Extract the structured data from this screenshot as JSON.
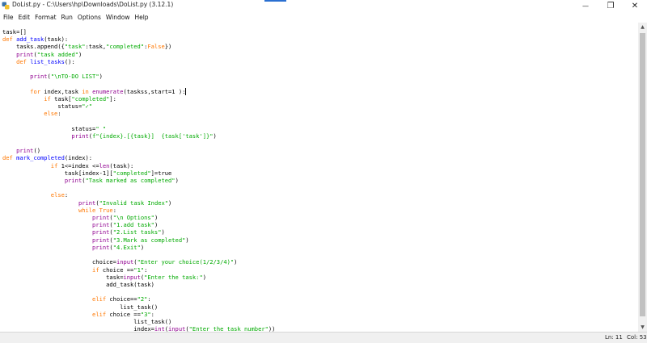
{
  "window": {
    "title": "DoList.py - C:\\Users\\hp\\Downloads\\DoList.py (3.12.1)",
    "minimize_glyph": "—",
    "maximize_glyph": "❐",
    "close_glyph": "✕"
  },
  "menu": [
    "File",
    "Edit",
    "Format",
    "Run",
    "Options",
    "Window",
    "Help"
  ],
  "code_lines": [
    [
      [
        "task=[]",
        ""
      ]
    ],
    [
      [
        "def ",
        "kw"
      ],
      [
        "add_task",
        "fn"
      ],
      [
        "(task):",
        ""
      ]
    ],
    [
      [
        "    tasks.append({",
        ""
      ],
      [
        "\"task\"",
        "st"
      ],
      [
        ":task,",
        ""
      ],
      [
        "\"completed\"",
        "st"
      ],
      [
        ":",
        ""
      ],
      [
        "False",
        "kw"
      ],
      [
        "})",
        ""
      ]
    ],
    [
      [
        "    ",
        ""
      ],
      [
        "print",
        "bi"
      ],
      [
        "(",
        ""
      ],
      [
        "\"task added\"",
        "st"
      ],
      [
        ")",
        ""
      ]
    ],
    [
      [
        "    ",
        ""
      ],
      [
        "def ",
        "kw"
      ],
      [
        "list_tasks",
        "fn"
      ],
      [
        "():",
        ""
      ]
    ],
    [
      [
        "",
        ""
      ]
    ],
    [
      [
        "        ",
        ""
      ],
      [
        "print",
        "bi"
      ],
      [
        "(",
        ""
      ],
      [
        "\"\\nTO-DO LIST\"",
        "st"
      ],
      [
        ")",
        ""
      ]
    ],
    [
      [
        "",
        ""
      ]
    ],
    [
      [
        "        ",
        ""
      ],
      [
        "for ",
        "kw"
      ],
      [
        "index,task ",
        ""
      ],
      [
        "in ",
        "kw"
      ],
      [
        "enumerate",
        "bi"
      ],
      [
        "(taskss,start=1 ):",
        ""
      ],
      [
        "|caret|",
        "caret"
      ]
    ],
    [
      [
        "            ",
        ""
      ],
      [
        "if ",
        "kw"
      ],
      [
        "task[",
        ""
      ],
      [
        "\"completed\"",
        "st"
      ],
      [
        "]:",
        ""
      ]
    ],
    [
      [
        "                status=",
        ""
      ],
      [
        "\"✓\"",
        "st"
      ]
    ],
    [
      [
        "            ",
        ""
      ],
      [
        "else",
        "kw"
      ],
      [
        ":",
        ""
      ]
    ],
    [
      [
        "",
        ""
      ]
    ],
    [
      [
        "                    status=",
        ""
      ],
      [
        "\" \"",
        "st"
      ]
    ],
    [
      [
        "                    ",
        ""
      ],
      [
        "print",
        "bi"
      ],
      [
        "(",
        ""
      ],
      [
        "f\"{index}.[{task}]  {task['task']}\"",
        "st"
      ],
      [
        ")",
        ""
      ]
    ],
    [
      [
        "",
        ""
      ]
    ],
    [
      [
        "    ",
        ""
      ],
      [
        "print",
        "bi"
      ],
      [
        "()",
        ""
      ]
    ],
    [
      [
        "def ",
        "kw"
      ],
      [
        "mark_completed",
        "fn"
      ],
      [
        "(index):",
        ""
      ]
    ],
    [
      [
        "              ",
        ""
      ],
      [
        "if ",
        "kw"
      ],
      [
        "1<=index <=",
        ""
      ],
      [
        "len",
        "bi"
      ],
      [
        "(task):",
        ""
      ]
    ],
    [
      [
        "                  task[index-1][",
        ""
      ],
      [
        "\"completed\"",
        "st"
      ],
      [
        "]=true",
        ""
      ]
    ],
    [
      [
        "                  ",
        ""
      ],
      [
        "print",
        "bi"
      ],
      [
        "(",
        ""
      ],
      [
        "\"Task marked as completed\"",
        "st"
      ],
      [
        ")",
        ""
      ]
    ],
    [
      [
        "",
        ""
      ]
    ],
    [
      [
        "              ",
        ""
      ],
      [
        "else",
        "kw"
      ],
      [
        ":",
        ""
      ]
    ],
    [
      [
        "                      ",
        ""
      ],
      [
        "print",
        "bi"
      ],
      [
        "(",
        ""
      ],
      [
        "\"Invalid task Index\"",
        "st"
      ],
      [
        ")",
        ""
      ]
    ],
    [
      [
        "                      ",
        ""
      ],
      [
        "while ",
        "kw"
      ],
      [
        "True",
        "kw"
      ],
      [
        ":",
        ""
      ]
    ],
    [
      [
        "                          ",
        ""
      ],
      [
        "print",
        "bi"
      ],
      [
        "(",
        ""
      ],
      [
        "\"\\n Options\"",
        "st"
      ],
      [
        ")",
        ""
      ]
    ],
    [
      [
        "                          ",
        ""
      ],
      [
        "print",
        "bi"
      ],
      [
        "(",
        ""
      ],
      [
        "\"1.add task\"",
        "st"
      ],
      [
        ")",
        ""
      ]
    ],
    [
      [
        "                          ",
        ""
      ],
      [
        "print",
        "bi"
      ],
      [
        "(",
        ""
      ],
      [
        "\"2.List tasks\"",
        "st"
      ],
      [
        ")",
        ""
      ]
    ],
    [
      [
        "                          ",
        ""
      ],
      [
        "print",
        "bi"
      ],
      [
        "(",
        ""
      ],
      [
        "\"3.Mark as completed\"",
        "st"
      ],
      [
        ")",
        ""
      ]
    ],
    [
      [
        "                          ",
        ""
      ],
      [
        "print",
        "bi"
      ],
      [
        "(",
        ""
      ],
      [
        "\"4.Exit\"",
        "st"
      ],
      [
        ")",
        ""
      ]
    ],
    [
      [
        "",
        ""
      ]
    ],
    [
      [
        "                          choice=",
        ""
      ],
      [
        "input",
        "bi"
      ],
      [
        "(",
        ""
      ],
      [
        "\"Enter your choice(1/2/3/4)\"",
        "st"
      ],
      [
        ")",
        ""
      ]
    ],
    [
      [
        "                          ",
        ""
      ],
      [
        "if ",
        "kw"
      ],
      [
        "choice ==",
        ""
      ],
      [
        "\"1\"",
        "st"
      ],
      [
        ":",
        ""
      ]
    ],
    [
      [
        "                              task=",
        ""
      ],
      [
        "input",
        "bi"
      ],
      [
        "(",
        ""
      ],
      [
        "\"Enter the task:\"",
        "st"
      ],
      [
        ")",
        ""
      ]
    ],
    [
      [
        "                              add_task(task)",
        ""
      ]
    ],
    [
      [
        "",
        ""
      ]
    ],
    [
      [
        "                          ",
        ""
      ],
      [
        "elif ",
        "kw"
      ],
      [
        "choice==",
        ""
      ],
      [
        "\"2\"",
        "st"
      ],
      [
        ":",
        ""
      ]
    ],
    [
      [
        "                                  list_task()",
        ""
      ]
    ],
    [
      [
        "                          ",
        ""
      ],
      [
        "elif ",
        "kw"
      ],
      [
        "choice ==",
        ""
      ],
      [
        "\"3\"",
        "st"
      ],
      [
        ":",
        ""
      ]
    ],
    [
      [
        "                                      list_task()",
        ""
      ]
    ],
    [
      [
        "                                      index=",
        ""
      ],
      [
        "int",
        "bi"
      ],
      [
        "(",
        ""
      ],
      [
        "input",
        "bi"
      ],
      [
        "(",
        ""
      ],
      [
        "\"Enter the task number\"",
        "st"
      ],
      [
        "))",
        ""
      ]
    ],
    [
      [
        "                                      mark_completed(index)",
        ""
      ]
    ]
  ],
  "status": {
    "line": "Ln: 11",
    "col": "Col: 53"
  },
  "colors": {
    "keyword": "#ff7700",
    "function_name": "#0000ff",
    "builtin": "#900090",
    "string": "#00aa00",
    "accent": "#2a6fd1"
  }
}
